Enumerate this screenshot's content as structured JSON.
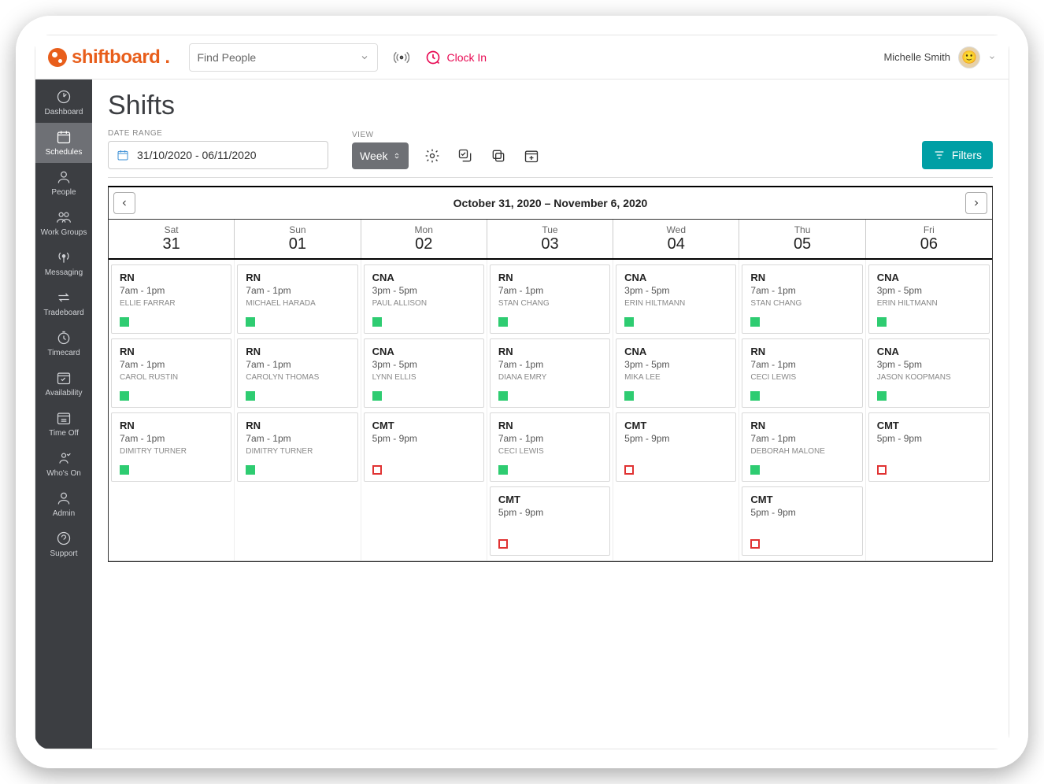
{
  "brand": "shiftboard",
  "topbar": {
    "find_placeholder": "Find People",
    "clockin_label": "Clock In",
    "user_name": "Michelle Smith"
  },
  "sidebar": [
    {
      "id": "dashboard",
      "label": "Dashboard"
    },
    {
      "id": "schedules",
      "label": "Schedules",
      "active": true
    },
    {
      "id": "people",
      "label": "People"
    },
    {
      "id": "workgroups",
      "label": "Work Groups"
    },
    {
      "id": "messaging",
      "label": "Messaging"
    },
    {
      "id": "tradeboard",
      "label": "Tradeboard"
    },
    {
      "id": "timecard",
      "label": "Timecard"
    },
    {
      "id": "availability",
      "label": "Availability"
    },
    {
      "id": "timeoff",
      "label": "Time Off"
    },
    {
      "id": "whoson",
      "label": "Who's On"
    },
    {
      "id": "admin",
      "label": "Admin"
    },
    {
      "id": "support",
      "label": "Support"
    }
  ],
  "page": {
    "title": "Shifts",
    "date_range_label": "DATE RANGE",
    "date_range_value": "31/10/2020 - 06/11/2020",
    "view_label": "VIEW",
    "week_btn": "Week",
    "filters_btn": "Filters",
    "range_title": "October 31, 2020 – November 6, 2020"
  },
  "daysHeader": [
    {
      "dow": "Sat",
      "num": "31"
    },
    {
      "dow": "Sun",
      "num": "01"
    },
    {
      "dow": "Mon",
      "num": "02"
    },
    {
      "dow": "Tue",
      "num": "03"
    },
    {
      "dow": "Wed",
      "num": "04"
    },
    {
      "dow": "Thu",
      "num": "05"
    },
    {
      "dow": "Fri",
      "num": "06"
    }
  ],
  "columns": [
    [
      {
        "role": "RN",
        "time": "7am - 1pm",
        "person": "ELLIE FARRAR",
        "status": "green"
      },
      {
        "role": "RN",
        "time": "7am - 1pm",
        "person": "CAROL RUSTIN",
        "status": "green"
      },
      {
        "role": "RN",
        "time": "7am - 1pm",
        "person": "DIMITRY TURNER",
        "status": "green"
      }
    ],
    [
      {
        "role": "RN",
        "time": "7am - 1pm",
        "person": "MICHAEL HARADA",
        "status": "green"
      },
      {
        "role": "RN",
        "time": "7am - 1pm",
        "person": "CAROLYN THOMAS",
        "status": "green"
      },
      {
        "role": "RN",
        "time": "7am - 1pm",
        "person": "DIMITRY TURNER",
        "status": "green"
      }
    ],
    [
      {
        "role": "CNA",
        "time": "3pm - 5pm",
        "person": "PAUL ALLISON",
        "status": "green"
      },
      {
        "role": "CNA",
        "time": "3pm - 5pm",
        "person": "LYNN ELLIS",
        "status": "green"
      },
      {
        "role": "CMT",
        "time": "5pm - 9pm",
        "person": "",
        "status": "red"
      }
    ],
    [
      {
        "role": "RN",
        "time": "7am - 1pm",
        "person": "STAN CHANG",
        "status": "green"
      },
      {
        "role": "RN",
        "time": "7am - 1pm",
        "person": "DIANA EMRY",
        "status": "green"
      },
      {
        "role": "RN",
        "time": "7am - 1pm",
        "person": "CECI LEWIS",
        "status": "green"
      },
      {
        "role": "CMT",
        "time": "5pm - 9pm",
        "person": "",
        "status": "red"
      }
    ],
    [
      {
        "role": "CNA",
        "time": "3pm - 5pm",
        "person": "ERIN HILTMANN",
        "status": "green"
      },
      {
        "role": "CNA",
        "time": "3pm - 5pm",
        "person": "MIKA LEE",
        "status": "green"
      },
      {
        "role": "CMT",
        "time": "5pm - 9pm",
        "person": "",
        "status": "red"
      }
    ],
    [
      {
        "role": "RN",
        "time": "7am - 1pm",
        "person": "STAN CHANG",
        "status": "green"
      },
      {
        "role": "RN",
        "time": "7am - 1pm",
        "person": "CECI LEWIS",
        "status": "green"
      },
      {
        "role": "RN",
        "time": "7am - 1pm",
        "person": "DEBORAH MALONE",
        "status": "green"
      },
      {
        "role": "CMT",
        "time": "5pm - 9pm",
        "person": "",
        "status": "red"
      }
    ],
    [
      {
        "role": "CNA",
        "time": "3pm - 5pm",
        "person": "ERIN HILTMANN",
        "status": "green"
      },
      {
        "role": "CNA",
        "time": "3pm - 5pm",
        "person": "JASON KOOPMANS",
        "status": "green"
      },
      {
        "role": "CMT",
        "time": "5pm - 9pm",
        "person": "",
        "status": "red"
      }
    ]
  ]
}
